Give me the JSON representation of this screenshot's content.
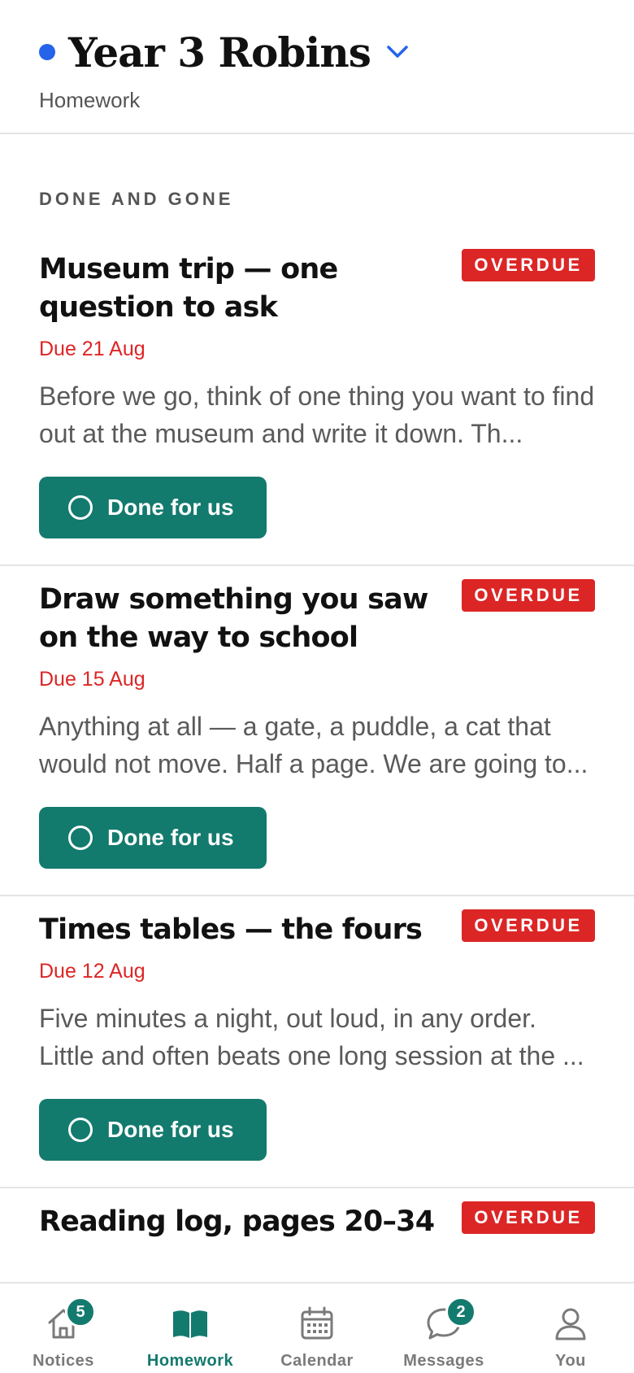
{
  "header": {
    "class_name": "Year 3 Robins",
    "subtitle": "Homework",
    "dot_color": "#2563eb",
    "switcher_icon": "chevron-down-icon"
  },
  "section": {
    "label": "DONE AND GONE"
  },
  "assignments": [
    {
      "title": "Museum trip — one question to ask",
      "badge": "OVERDUE",
      "due": "Due 21 Aug",
      "description": "Before we go, think of one thing you want to find out at the museum and write it down. Th...",
      "action_label": "Done for us"
    },
    {
      "title": "Draw something you saw on the way to school",
      "badge": "OVERDUE",
      "due": "Due 15 Aug",
      "description": "Anything at all — a gate, a puddle, a cat that would not move. Half a page. We are going to...",
      "action_label": "Done for us"
    },
    {
      "title": "Times tables — the fours",
      "badge": "OVERDUE",
      "due": "Due 12 Aug",
      "description": "Five minutes a night, out loud, in any order. Little and often beats one long session at the ...",
      "action_label": "Done for us"
    },
    {
      "title": "Reading log, pages 20–34",
      "badge": "OVERDUE"
    }
  ],
  "tabs": [
    {
      "label": "Notices",
      "icon": "home-icon",
      "badge": "5",
      "active": false
    },
    {
      "label": "Homework",
      "icon": "book-icon",
      "active": true
    },
    {
      "label": "Calendar",
      "icon": "calendar-icon",
      "active": false
    },
    {
      "label": "Messages",
      "icon": "chat-bubble-icon",
      "badge": "2",
      "active": false
    },
    {
      "label": "You",
      "icon": "person-icon",
      "active": false
    }
  ],
  "colors": {
    "accent": "#137a6e",
    "overdue": "#dc2626",
    "dot": "#2563eb"
  }
}
